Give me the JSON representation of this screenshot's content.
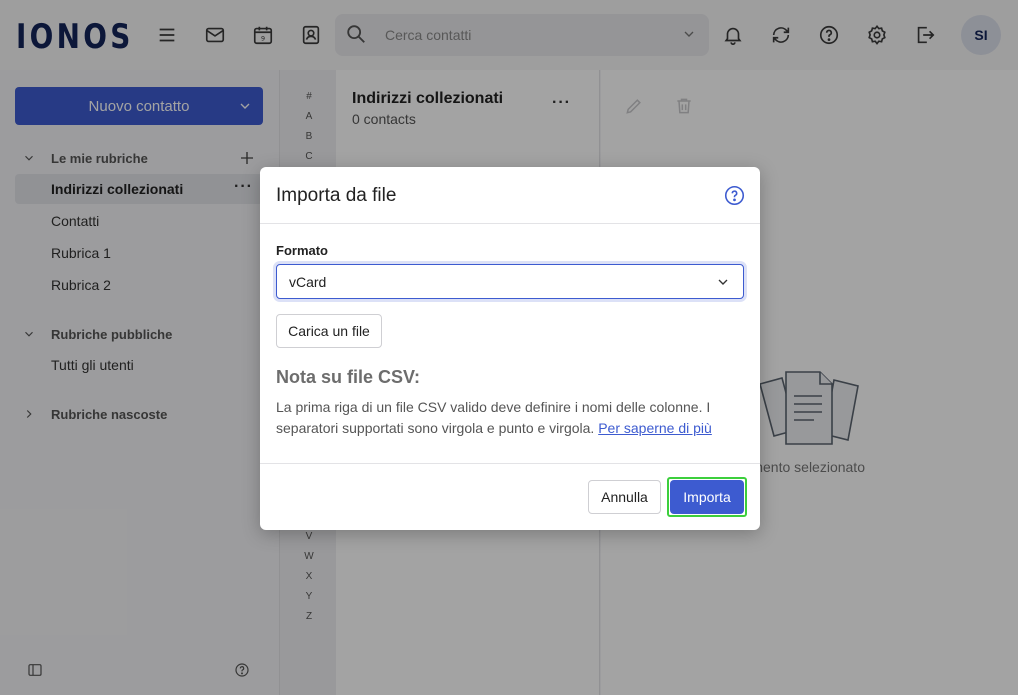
{
  "brand": {
    "logo": "IONOS"
  },
  "topbar": {
    "search_placeholder": "Cerca contatti",
    "avatar_initials": "SI"
  },
  "sidebar": {
    "new_contact_label": "Nuovo contatto",
    "sections": [
      {
        "label": "Le mie rubriche"
      },
      {
        "label": "Rubriche pubbliche"
      },
      {
        "label": "Rubriche nascoste"
      }
    ],
    "my_books": [
      {
        "label": "Indirizzi collezionati",
        "active": true
      },
      {
        "label": "Contatti"
      },
      {
        "label": "Rubrica 1"
      },
      {
        "label": "Rubrica 2"
      }
    ],
    "public_books": [
      {
        "label": "Tutti gli utenti"
      }
    ],
    "more_glyph": "···"
  },
  "alphabet": [
    "#",
    "A",
    "B",
    "C",
    "V",
    "W",
    "X",
    "Y",
    "Z"
  ],
  "list": {
    "title": "Indirizzi collezionati",
    "subtitle": "0 contacts",
    "more_glyph": "···"
  },
  "detail": {
    "empty_text": "n elemento selezionato"
  },
  "modal": {
    "title": "Importa da file",
    "format_label": "Formato",
    "format_value": "vCard",
    "upload_label": "Carica un file",
    "note_heading": "Nota su file CSV:",
    "note_text": "La prima riga di un file CSV valido deve definire i nomi delle colonne. I separatori supportati sono virgola e punto e virgola.",
    "note_link": "Per saperne di più",
    "cancel_label": "Annulla",
    "import_label": "Importa"
  },
  "colors": {
    "accent": "#3d5bd0",
    "brand_dark": "#14245a",
    "highlight_ring": "#3ccf3c"
  }
}
